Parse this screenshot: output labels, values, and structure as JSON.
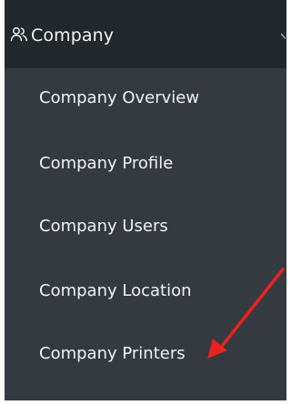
{
  "header": {
    "icon": "users-icon",
    "label": "Company",
    "toggle_icon": "chevron-down-icon"
  },
  "menu": {
    "items": [
      {
        "label": "Company Overview"
      },
      {
        "label": "Company Profile"
      },
      {
        "label": "Company Users"
      },
      {
        "label": "Company Location"
      },
      {
        "label": "Company Printers"
      }
    ]
  },
  "annotation": {
    "icon": "red-arrow-icon",
    "color": "#e8231f"
  },
  "colors": {
    "sidebar_bg": "#343a40",
    "header_bg": "#22272b",
    "text": "#f0f2f3"
  }
}
